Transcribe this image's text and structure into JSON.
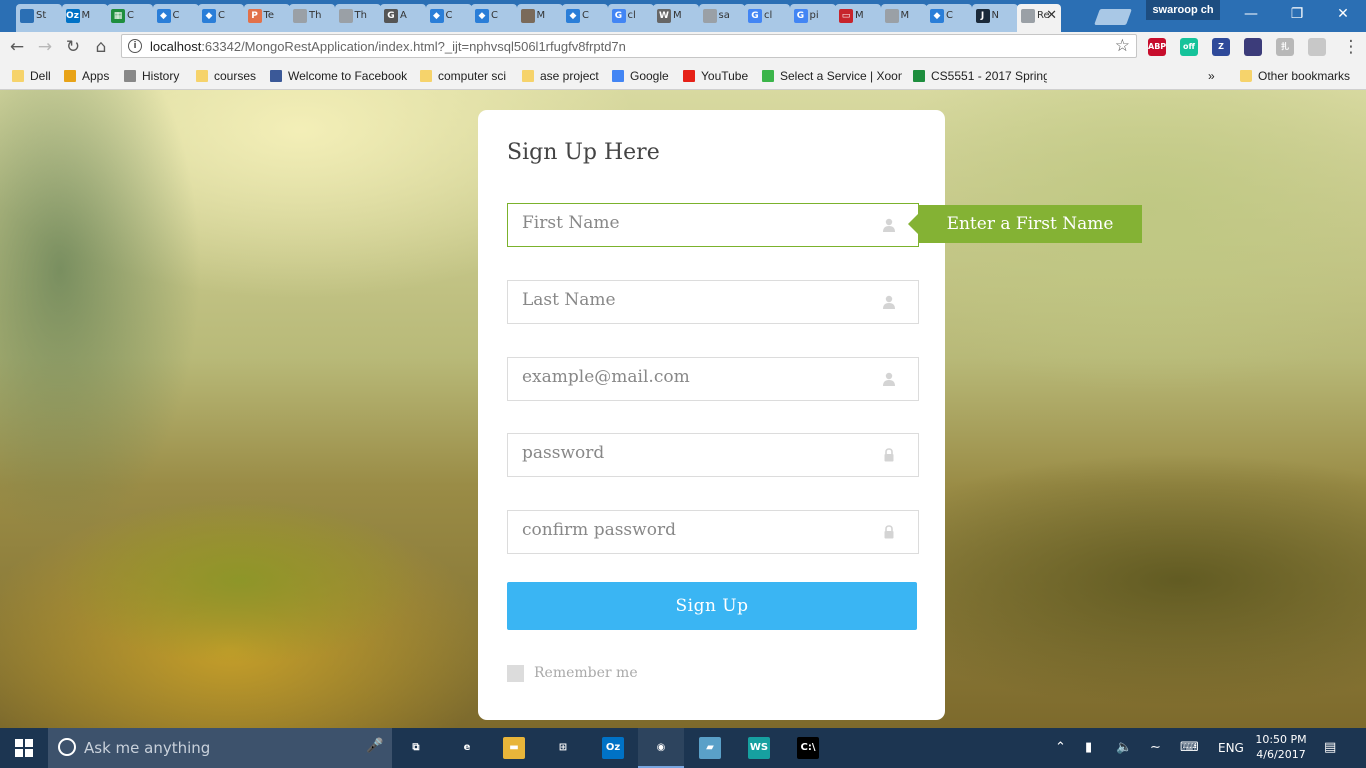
{
  "browser": {
    "tabs": [
      {
        "title": "St",
        "icon": "stripe-icon",
        "color": "#2b6fb4",
        "glyph": ""
      },
      {
        "title": "M",
        "icon": "outlook-icon",
        "color": "#0072c6",
        "glyph": "Oz"
      },
      {
        "title": "C",
        "icon": "sheets-icon",
        "color": "#1e8e3e",
        "glyph": "▦"
      },
      {
        "title": "C",
        "icon": "dropbox-icon",
        "color": "#2a7ed8",
        "glyph": "◆"
      },
      {
        "title": "C",
        "icon": "dropbox-icon",
        "color": "#2a7ed8",
        "glyph": "◆"
      },
      {
        "title": "Te",
        "icon": "p-icon",
        "color": "#e2714a",
        "glyph": "P"
      },
      {
        "title": "Th",
        "icon": "page-icon",
        "color": "#9aa0a6",
        "glyph": ""
      },
      {
        "title": "Th",
        "icon": "page-icon",
        "color": "#9aa0a6",
        "glyph": ""
      },
      {
        "title": "A",
        "icon": "g-icon",
        "color": "#555555",
        "glyph": "G"
      },
      {
        "title": "C",
        "icon": "dropbox-icon",
        "color": "#2a7ed8",
        "glyph": "◆"
      },
      {
        "title": "C",
        "icon": "dropbox-icon",
        "color": "#2a7ed8",
        "glyph": "◆"
      },
      {
        "title": "M",
        "icon": "avatar-icon",
        "color": "#7a6a5a",
        "glyph": ""
      },
      {
        "title": "C",
        "icon": "dropbox-icon",
        "color": "#2a7ed8",
        "glyph": "◆"
      },
      {
        "title": "cl",
        "icon": "google-icon",
        "color": "#4285f4",
        "glyph": "G"
      },
      {
        "title": "M",
        "icon": "wikipedia-icon",
        "color": "#666666",
        "glyph": "W"
      },
      {
        "title": "sa",
        "icon": "page-icon",
        "color": "#9aa0a6",
        "glyph": ""
      },
      {
        "title": "cl",
        "icon": "google-icon",
        "color": "#4285f4",
        "glyph": "G"
      },
      {
        "title": "pi",
        "icon": "google-icon",
        "color": "#4285f4",
        "glyph": "G"
      },
      {
        "title": "M",
        "icon": "oracle-icon",
        "color": "#c7242c",
        "glyph": "▭"
      },
      {
        "title": "M",
        "icon": "page-icon",
        "color": "#9aa0a6",
        "glyph": ""
      },
      {
        "title": "C",
        "icon": "dropbox-icon",
        "color": "#2a7ed8",
        "glyph": "◆"
      },
      {
        "title": "N",
        "icon": "j-icon",
        "color": "#1b2a3a",
        "glyph": "J"
      },
      {
        "title": "Re",
        "icon": "page-icon",
        "color": "#9aa0a6",
        "glyph": "",
        "active": true
      }
    ],
    "profile_name": "swaroop ch",
    "url_host": "localhost",
    "url_path": ":63342/MongoRestApplication/index.html?_ijt=nphvsql506l1rfugfv8frptd7n",
    "extensions": [
      {
        "icon": "adblock-plus-icon",
        "label": "ABP",
        "color": "#c70d2c"
      },
      {
        "icon": "grammarly-icon",
        "label": "off",
        "color": "#15c39a"
      },
      {
        "icon": "zotero-icon",
        "label": "Z",
        "color": "#2f4a9a"
      },
      {
        "icon": "extension-icon",
        "label": "",
        "color": "#3c3c7a"
      },
      {
        "icon": "translate-icon",
        "label": "扎",
        "color": "#b8b8b8"
      },
      {
        "icon": "shield-icon",
        "label": "",
        "color": "#c8c8c8"
      }
    ],
    "bookmarks": [
      {
        "label": "Dell",
        "icon": "folder-icon"
      },
      {
        "label": "Apps",
        "icon": "apps-icon"
      },
      {
        "label": "History",
        "icon": "history-icon"
      },
      {
        "label": "courses",
        "icon": "folder-icon"
      },
      {
        "label": "Welcome to Facebook",
        "icon": "facebook-icon"
      },
      {
        "label": "computer sci",
        "icon": "folder-icon"
      },
      {
        "label": "ase project",
        "icon": "folder-icon"
      },
      {
        "label": "Google",
        "icon": "google-icon"
      },
      {
        "label": "YouTube",
        "icon": "youtube-icon"
      },
      {
        "label": "Select a Service | Xoom",
        "icon": "xoom-icon"
      },
      {
        "label": "CS5551 - 2017 Spring",
        "icon": "sheets-icon"
      }
    ],
    "overflow": "»",
    "other_bookmarks": "Other bookmarks"
  },
  "form": {
    "title": "Sign Up Here",
    "fields": [
      {
        "placeholder": "First Name",
        "icon": "user-icon",
        "value": ""
      },
      {
        "placeholder": "Last Name",
        "icon": "user-icon",
        "value": ""
      },
      {
        "placeholder": "example@mail.com",
        "icon": "user-icon",
        "value": ""
      },
      {
        "placeholder": "password",
        "icon": "lock-icon",
        "value": ""
      },
      {
        "placeholder": "confirm password",
        "icon": "lock-icon",
        "value": ""
      }
    ],
    "tooltip": "Enter a First Name",
    "submit_label": "Sign Up",
    "remember_label": "Remember me",
    "colors": {
      "accent_button": "#3ab5f3",
      "validation_green": "#84b234"
    }
  },
  "taskbar": {
    "search_placeholder": "Ask me anything",
    "apps": [
      {
        "icon": "task-view-icon",
        "glyph": "⧉"
      },
      {
        "icon": "edge-icon",
        "glyph": "e"
      },
      {
        "icon": "file-explorer-icon",
        "glyph": "▬"
      },
      {
        "icon": "store-icon",
        "glyph": "⊞"
      },
      {
        "icon": "outlook-icon",
        "glyph": "Oz"
      },
      {
        "icon": "chrome-icon",
        "glyph": "◉"
      },
      {
        "icon": "notepad-icon",
        "glyph": "▰"
      },
      {
        "icon": "webstorm-icon",
        "glyph": "WS"
      },
      {
        "icon": "terminal-icon",
        "glyph": "C:\\"
      }
    ],
    "language": "ENG",
    "time": "10:50 PM",
    "date": "4/6/2017"
  }
}
